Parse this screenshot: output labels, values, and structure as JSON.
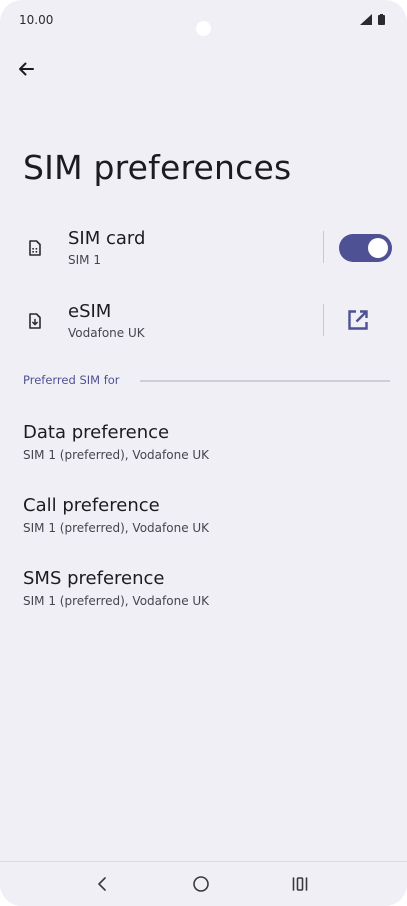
{
  "status_bar": {
    "time": "10.00"
  },
  "page": {
    "title": "SIM preferences"
  },
  "sim_card": {
    "title": "SIM card",
    "subtitle": "SIM 1",
    "enabled": true
  },
  "esim": {
    "title": "eSIM",
    "subtitle": "Vodafone UK"
  },
  "section": {
    "header": "Preferred SIM for"
  },
  "preferences": [
    {
      "title": "Data preference",
      "value": "SIM 1 (preferred), Vodafone UK"
    },
    {
      "title": "Call preference",
      "value": "SIM 1 (preferred), Vodafone UK"
    },
    {
      "title": "SMS preference",
      "value": "SIM 1 (preferred), Vodafone UK"
    }
  ],
  "colors": {
    "accent": "#4e5193",
    "background": "#f1eff6",
    "text": "#1c1b20"
  },
  "icons": {
    "back": "arrow-left-icon",
    "sim": "sim-card-icon",
    "esim": "esim-download-icon",
    "external": "open-external-icon",
    "nav_back": "chevron-left-icon",
    "nav_home": "circle-home-icon",
    "nav_recents": "recents-icon"
  }
}
